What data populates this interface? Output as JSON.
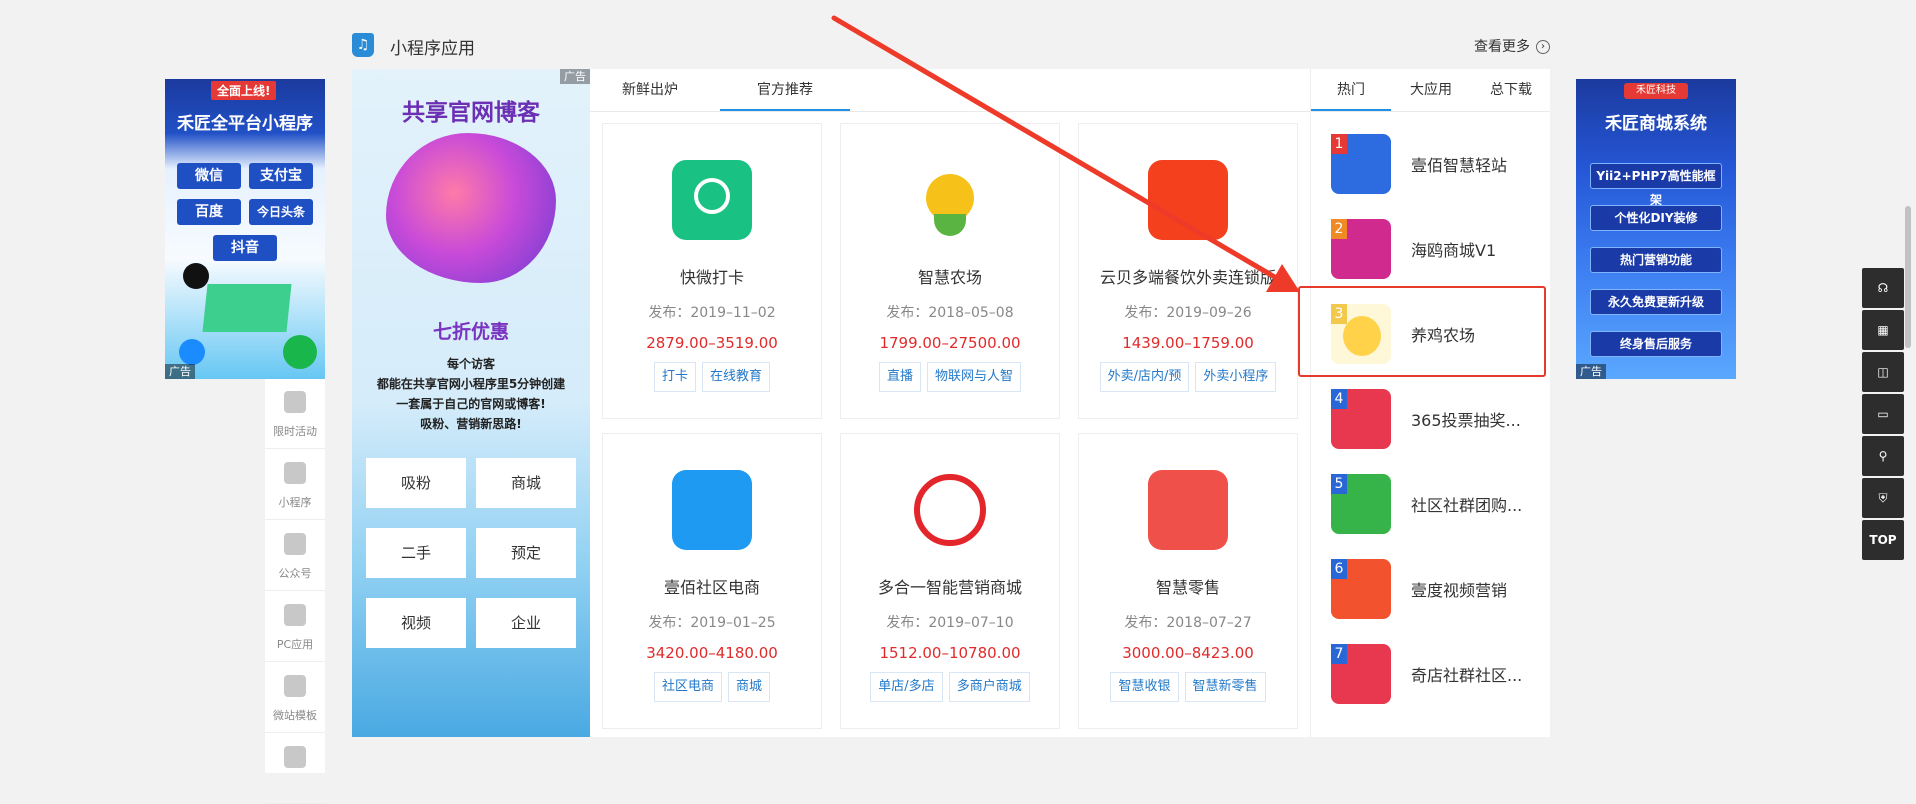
{
  "section": {
    "title": "小程序应用",
    "more": "查看更多",
    "icon": "mini-program-bag-icon"
  },
  "ad_left": {
    "badge": "全面上线!",
    "title": "禾匠全平台小程序",
    "buttons": [
      "微信",
      "支付宝",
      "百度",
      "今日头条",
      "抖音"
    ],
    "tag": "广告"
  },
  "ad_right": {
    "logo": "禾匠科技",
    "title": "禾匠商城系统",
    "features": [
      "Yii2+PHP7高性能框架",
      "个性化DIY装修",
      "热门营销功能",
      "永久免费更新升级",
      "终身售后服务"
    ],
    "tag": "广告"
  },
  "sidenav": [
    {
      "label": "限时活动",
      "icon": "clock-icon"
    },
    {
      "label": "小程序",
      "icon": "bag-icon"
    },
    {
      "label": "公众号",
      "icon": "bag-icon"
    },
    {
      "label": "PC应用",
      "icon": "monitor-icon"
    },
    {
      "label": "微站模板",
      "icon": "chat-icon"
    },
    {
      "label": "",
      "icon": "grid-icon"
    }
  ],
  "promo": {
    "tag": "广告",
    "title": "共享官网博客",
    "subtitle": "七折优惠",
    "lines": [
      "每个访客",
      "都能在共享官网小程序里5分钟创建",
      "一套属于自己的官网或博客!",
      "吸粉、营销新思路!"
    ],
    "grid": [
      "吸粉",
      "商城",
      "二手",
      "预定",
      "视频",
      "企业"
    ]
  },
  "tabs": {
    "items": [
      "新鲜出炉",
      "官方推荐"
    ],
    "active": 1
  },
  "apps": [
    {
      "name": "快微打卡",
      "date": "发布：2019–11–02",
      "price": "2879.00–3519.00",
      "tags": [
        "打卡",
        "在线教育"
      ],
      "color": "#19c183",
      "icon": "location-clock-icon"
    },
    {
      "name": "智慧农场",
      "date": "发布：2018–05–08",
      "price": "1799.00–27500.00",
      "tags": [
        "直播",
        "物联网与人智"
      ],
      "color": "#ffffff",
      "icon": "sunflower-icon"
    },
    {
      "name": "云贝多端餐饮外卖连锁版",
      "date": "发布：2019–09–26",
      "price": "1439.00–1759.00",
      "tags": [
        "外卖/店内/预",
        "外卖小程序"
      ],
      "color": "#f5401e",
      "icon": "yunbei-icon"
    },
    {
      "name": "壹佰社区电商",
      "date": "发布：2019–01–25",
      "price": "3420.00–4180.00",
      "tags": [
        "社区电商",
        "商城"
      ],
      "color": "#1e9af3",
      "icon": "community-ecommerce-icon"
    },
    {
      "name": "多合一智能营销商城",
      "date": "发布：2019–07–10",
      "price": "1512.00–10780.00",
      "tags": [
        "单店/多店",
        "多商户商城"
      ],
      "color": "#ffffff",
      "icon": "shopping-cart-icon"
    },
    {
      "name": "智慧零售",
      "date": "发布：2018–07–27",
      "price": "3000.00–8423.00",
      "tags": [
        "智慧收银",
        "智慧新零售"
      ],
      "color": "#f0504a",
      "icon": "retail-icon"
    }
  ],
  "rank_tabs": {
    "items": [
      "热门",
      "大应用",
      "总下载"
    ],
    "active": 0
  },
  "ranking": [
    {
      "num": "1",
      "name": "壹佰智慧轻站",
      "color": "#2c6ce0"
    },
    {
      "num": "2",
      "name": "海鸥商城V1",
      "color": "#d02a8e"
    },
    {
      "num": "3",
      "name": "养鸡农场",
      "color": "#ffd24a"
    },
    {
      "num": "4",
      "name": "365投票抽奖...",
      "color": "#e8384f"
    },
    {
      "num": "5",
      "name": "社区社群团购...",
      "color": "#36b44a"
    },
    {
      "num": "6",
      "name": "壹度视频营销",
      "color": "#f2522e"
    },
    {
      "num": "7",
      "name": "奇店社群社区...",
      "color": "#e8384f"
    }
  ],
  "toolbar": [
    {
      "icon": "headset-icon",
      "label": ""
    },
    {
      "icon": "calendar-icon",
      "label": ""
    },
    {
      "icon": "bag-icon",
      "label": ""
    },
    {
      "icon": "wallet-icon",
      "label": ""
    },
    {
      "icon": "user-search-icon",
      "label": ""
    },
    {
      "icon": "shield-icon",
      "label": ""
    },
    {
      "icon": "top-icon",
      "label": "TOP"
    }
  ]
}
